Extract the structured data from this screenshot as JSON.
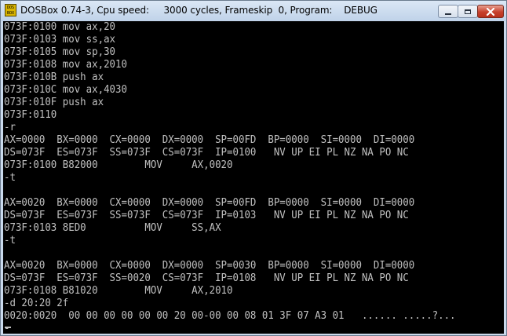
{
  "window": {
    "title": "DOSBox 0.74-3, Cpu speed:     3000 cycles, Frameskip  0, Program:    DEBUG",
    "icon_label": "DOS BOX",
    "icon": "dosbox-app-icon"
  },
  "controls": {
    "minimize": "minimize-icon",
    "maximize": "maximize-icon",
    "close": "close-icon"
  },
  "console": {
    "text_color": "#c0c0c0",
    "background": "#000000",
    "lines": [
      "073F:0100 mov ax,20",
      "073F:0103 mov ss,ax",
      "073F:0105 mov sp,30",
      "073F:0108 mov ax,2010",
      "073F:010B push ax",
      "073F:010C mov ax,4030",
      "073F:010F push ax",
      "073F:0110",
      "-r",
      "AX=0000  BX=0000  CX=0000  DX=0000  SP=00FD  BP=0000  SI=0000  DI=0000",
      "DS=073F  ES=073F  SS=073F  CS=073F  IP=0100   NV UP EI PL NZ NA PO NC",
      "073F:0100 B82000        MOV     AX,0020",
      "-t",
      "",
      "AX=0020  BX=0000  CX=0000  DX=0000  SP=00FD  BP=0000  SI=0000  DI=0000",
      "DS=073F  ES=073F  SS=073F  CS=073F  IP=0103   NV UP EI PL NZ NA PO NC",
      "073F:0103 8ED0          MOV     SS,AX",
      "-t",
      "",
      "AX=0020  BX=0000  CX=0000  DX=0000  SP=0030  BP=0000  SI=0000  DI=0000",
      "DS=073F  ES=073F  SS=0020  CS=073F  IP=0108   NV UP EI PL NZ NA PO NC",
      "073F:0108 B81020        MOV     AX,2010",
      "-d 20:20 2f",
      "0020:0020  00 00 00 00 00 00 20 00-00 00 08 01 3F 07 A3 01   ...... .....?...",
      "-"
    ]
  }
}
